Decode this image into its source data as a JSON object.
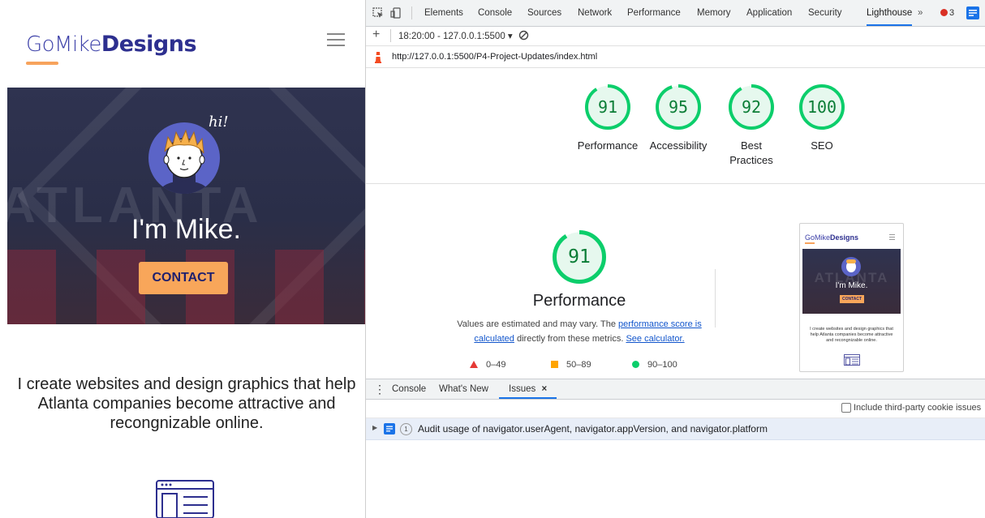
{
  "site": {
    "logo_part1": "GoMike",
    "logo_part2": "Designs",
    "hero_bg_text": "ATLANTA",
    "hi_text": "hi!",
    "hero_title": "I'm Mike.",
    "contact_label": "CONTACT",
    "tagline": "I create websites and design graphics that help Atlanta companies become attractive and recongnizable online."
  },
  "devtools": {
    "tabs": [
      {
        "label": "Elements"
      },
      {
        "label": "Console"
      },
      {
        "label": "Sources"
      },
      {
        "label": "Network"
      },
      {
        "label": "Performance"
      },
      {
        "label": "Memory"
      },
      {
        "label": "Application"
      },
      {
        "label": "Security"
      },
      {
        "label": "Lighthouse"
      }
    ],
    "more_label": "»",
    "error_count": "3",
    "report_selector": "18:20:00 - 127.0.0.1:5500 ▾",
    "add_label": "+",
    "url": "http://127.0.0.1:5500/P4-Project-Updates/index.html",
    "scores": [
      {
        "label": "Performance",
        "value": "91",
        "fraction": 0.91
      },
      {
        "label": "Accessibility",
        "value": "95",
        "fraction": 0.95
      },
      {
        "label": "Best Practices",
        "value": "92",
        "fraction": 0.92
      },
      {
        "label": "SEO",
        "value": "100",
        "fraction": 1.0
      }
    ],
    "perf": {
      "score": "91",
      "fraction": 0.91,
      "title": "Performance",
      "desc_1": "Values are estimated and may vary. The ",
      "desc_link1": "performance score is calculated",
      "desc_2": " directly from these metrics. ",
      "desc_link2": "See calculator.",
      "legend": [
        {
          "range": "0–49",
          "color": "#e53935",
          "shape": "triangle"
        },
        {
          "range": "50–89",
          "color": "#ffa400",
          "shape": "square"
        },
        {
          "range": "90–100",
          "color": "#0cce6b",
          "shape": "circle"
        }
      ]
    },
    "thumb": {
      "logo_part1": "GoMike",
      "logo_part2": "Designs",
      "title": "I'm Mike.",
      "contact": "CONTACT",
      "tagline": "I create websites and design graphics that help Atlanta companies become attractive and recongnizable online."
    },
    "drawer": {
      "menu": "⋮",
      "tabs": [
        {
          "label": "Console"
        },
        {
          "label": "What's New"
        },
        {
          "label": "Issues"
        }
      ],
      "close": "×",
      "cookie_label": "Include third-party cookie issues",
      "issue_count": "1",
      "issue_text": "Audit usage of navigator.userAgent, navigator.appVersion, and navigator.platform"
    },
    "colors": {
      "pass": "#0cce6b",
      "pass_text": "#0a7d36",
      "accent": "#1a73e8"
    }
  }
}
